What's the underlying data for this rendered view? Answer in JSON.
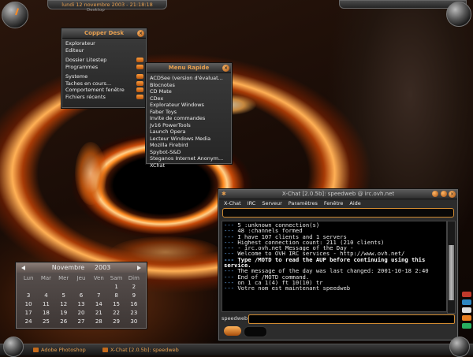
{
  "clock": {
    "text": "lundi 12 novembre 2003 - 21:18:18",
    "subtext": "Desktop"
  },
  "copper_desk": {
    "title": "Copper Desk",
    "items": [
      {
        "label": "Explorateur",
        "submenu": false
      },
      {
        "label": "Editeur",
        "submenu": false
      },
      {
        "label": "",
        "separator": true
      },
      {
        "label": "Dossier Litestep",
        "submenu": true
      },
      {
        "label": "Programmes",
        "submenu": true
      },
      {
        "label": "",
        "separator": true
      },
      {
        "label": "Systeme",
        "submenu": true
      },
      {
        "label": "Taches en cours...",
        "submenu": true
      },
      {
        "label": "Comportement fenêtre",
        "submenu": true
      },
      {
        "label": "Fichiers récents",
        "submenu": true
      }
    ]
  },
  "menu_rapide": {
    "title": "Menu Rapide",
    "items": [
      "ACDSee (version d'évaluat...",
      "Blocnotes",
      "CD Mate",
      "CDex",
      "Explorateur Windows",
      "Faber Toys",
      "Invite de commandes",
      "Jv16 PowerTools",
      "Launch Opera",
      "Lecteur Windows Media",
      "Mozilla Firebird",
      "Spybot-S&D",
      "Steganos Internet Anonym...",
      "XChat"
    ]
  },
  "calendar": {
    "month": "Novembre",
    "year": "2003",
    "weekdays": [
      "Lun",
      "Mar",
      "Mer",
      "Jeu",
      "Ven",
      "Sam",
      "Dim"
    ],
    "weeks": [
      [
        "",
        "",
        "",
        "",
        "",
        "1",
        "2"
      ],
      [
        "3",
        "4",
        "5",
        "6",
        "7",
        "8",
        "9"
      ],
      [
        "10",
        "11",
        "12",
        "13",
        "14",
        "15",
        "16"
      ],
      [
        "17",
        "18",
        "19",
        "20",
        "21",
        "22",
        "23"
      ],
      [
        "24",
        "25",
        "26",
        "27",
        "28",
        "29",
        "30"
      ]
    ]
  },
  "xchat": {
    "title": "X-Chat [2.0.5b]: speedweb @ irc.ovh.net",
    "menu": [
      "X-Chat",
      "IRC",
      "Serveur",
      "Paramètres",
      "Fenêtre",
      "Aide"
    ],
    "log": [
      {
        "prefix": "---",
        "text": "5 :unknown connection(s)",
        "bold": false
      },
      {
        "prefix": "---",
        "text": "48 :channels formed",
        "bold": false
      },
      {
        "prefix": "---",
        "text": "I have 107 clients and 1 servers",
        "bold": false
      },
      {
        "prefix": "---",
        "text": "Highest connection count: 211 (210 clients)",
        "bold": false
      },
      {
        "prefix": "---",
        "text": "- irc.ovh.net Message of the Day -",
        "bold": false
      },
      {
        "prefix": "---",
        "text": "Welcome to OVH IRC services - http://www.ovh.net/",
        "bold": false
      },
      {
        "prefix": "---",
        "text": "Type /MOTD to read the AUP before continuing using this service.",
        "bold": true
      },
      {
        "prefix": "---",
        "text": "The message of the day was last changed: 2001-10-18 2:40",
        "bold": false
      },
      {
        "prefix": "---",
        "text": "End of /MOTD command.",
        "bold": false
      },
      {
        "prefix": "---",
        "text": "on 1 ca 1(4) ft 10(10) tr",
        "bold": false
      },
      {
        "prefix": "---",
        "text": "Votre nom est maintenant speedweb",
        "bold": false
      }
    ],
    "nick": "speedweb"
  },
  "taskbar": {
    "tasks": [
      "Adobe Photoshop",
      "X-Chat [2.0.5b]: speedweb"
    ]
  },
  "colors": {
    "accent": "#e8a050",
    "chrome": "#2c2c2c"
  }
}
